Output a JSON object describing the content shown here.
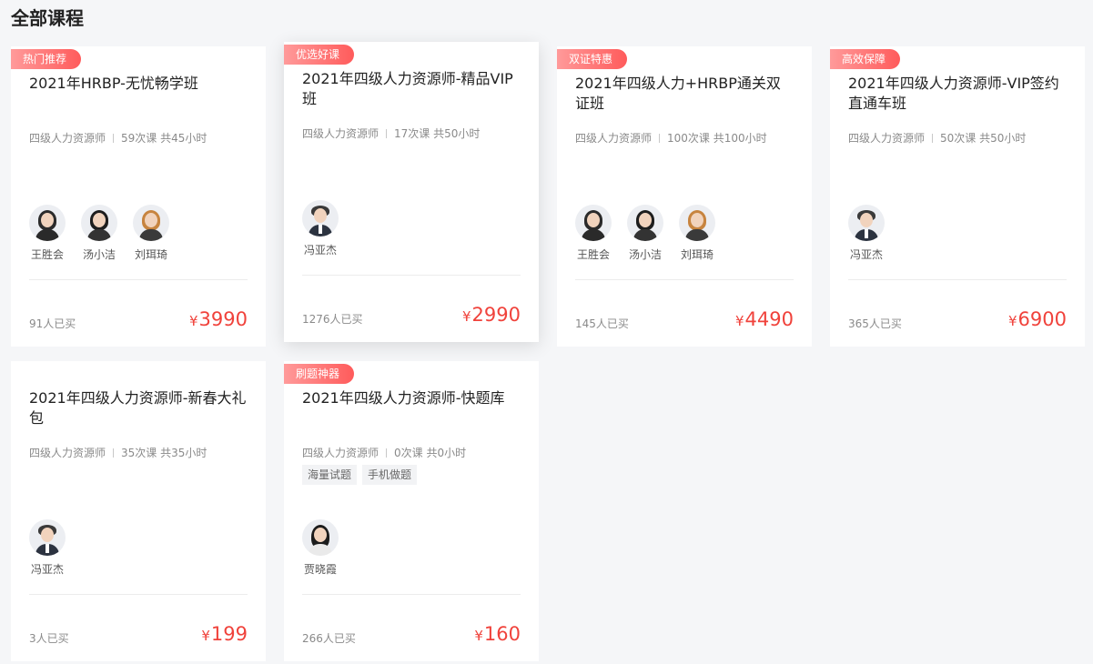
{
  "page": {
    "title": "全部课程"
  },
  "courses": [
    {
      "badge": "热门推荐",
      "title": "2021年HRBP-无忧畅学班",
      "category": "四级人力资源师",
      "lessons": "59次课 共45小时",
      "tags": [],
      "teachers": [
        "王胜会",
        "汤小洁",
        "刘珥琦"
      ],
      "buyers": "91人已买",
      "currency": "¥",
      "price": "3990"
    },
    {
      "badge": "优选好课",
      "title": "2021年四级人力资源师-精品VIP班",
      "category": "四级人力资源师",
      "lessons": "17次课 共50小时",
      "tags": [],
      "teachers": [
        "冯亚杰"
      ],
      "buyers": "1276人已买",
      "currency": "¥",
      "price": "2990"
    },
    {
      "badge": "双证特惠",
      "title": "2021年四级人力+HRBP通关双证班",
      "category": "四级人力资源师",
      "lessons": "100次课 共100小时",
      "tags": [],
      "teachers": [
        "王胜会",
        "汤小洁",
        "刘珥琦"
      ],
      "buyers": "145人已买",
      "currency": "¥",
      "price": "4490"
    },
    {
      "badge": "高效保障",
      "title": "2021年四级人力资源师-VIP签约直通车班",
      "category": "四级人力资源师",
      "lessons": "50次课 共50小时",
      "tags": [],
      "teachers": [
        "冯亚杰"
      ],
      "buyers": "365人已买",
      "currency": "¥",
      "price": "6900"
    },
    {
      "badge": "",
      "title": "2021年四级人力资源师-新春大礼包",
      "category": "四级人力资源师",
      "lessons": "35次课 共35小时",
      "tags": [],
      "teachers": [
        "冯亚杰"
      ],
      "buyers": "3人已买",
      "currency": "¥",
      "price": "199"
    },
    {
      "badge": "刷题神器",
      "title": "2021年四级人力资源师-快题库",
      "category": "四级人力资源师",
      "lessons": "0次课 共0小时",
      "tags": [
        "海量试题",
        "手机做题"
      ],
      "teachers": [
        "贾晓霞"
      ],
      "buyers": "266人已买",
      "currency": "¥",
      "price": "160"
    }
  ],
  "colors": {
    "price": "#f0423b",
    "badge_start": "#ff9a9a",
    "badge_end": "#ff5b5b"
  }
}
